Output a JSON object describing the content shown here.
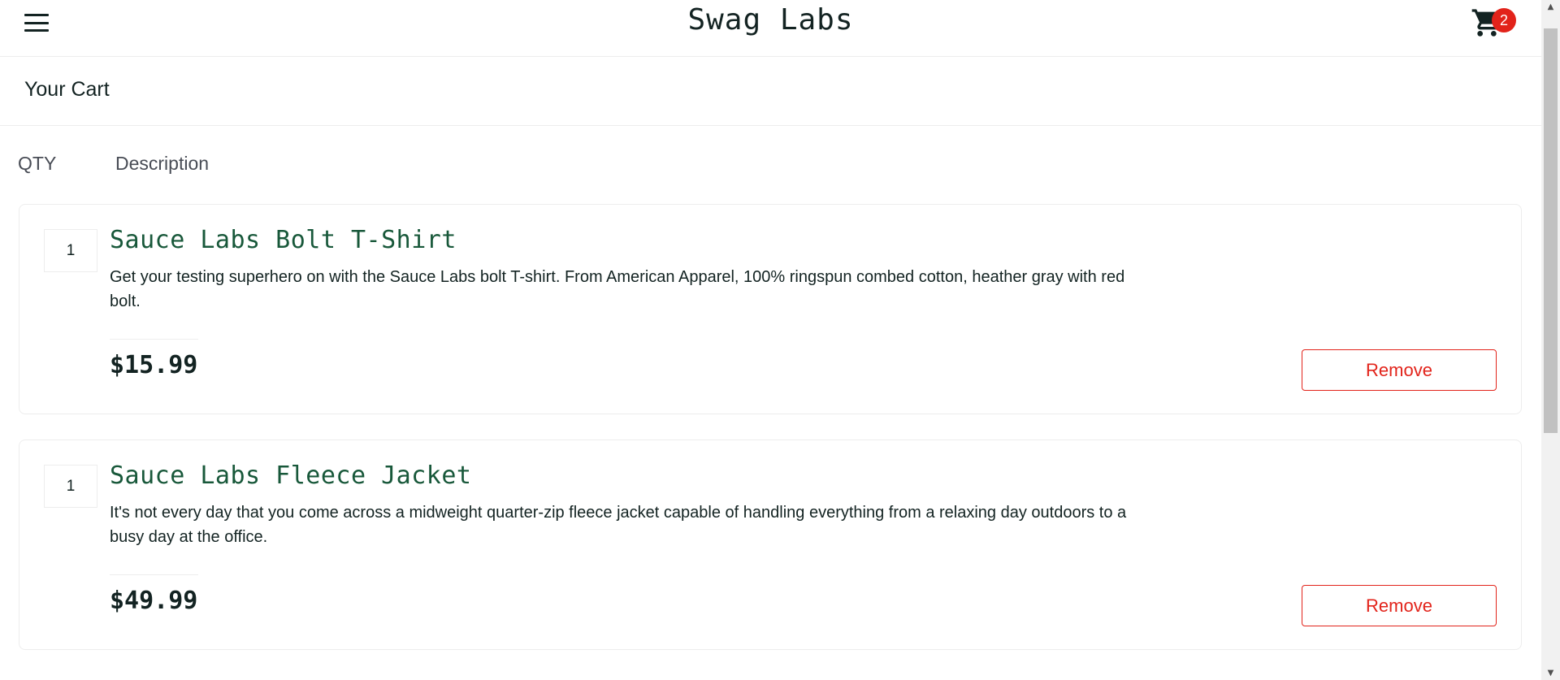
{
  "header": {
    "logo": "Swag Labs",
    "menu_icon": "hamburger-menu-icon",
    "cart_icon": "shopping-cart-icon",
    "cart_badge": "2",
    "accent_color": "#e2231a"
  },
  "secondary_header": {
    "title": "Your Cart"
  },
  "cart_list": {
    "qty_label": "QTY",
    "desc_label": "Description",
    "items": [
      {
        "quantity": "1",
        "name": "Sauce Labs Bolt T-Shirt",
        "description": "Get your testing superhero on with the Sauce Labs bolt T-shirt. From American Apparel, 100% ringspun combed cotton, heather gray with red bolt.",
        "price": "$15.99",
        "remove_label": "Remove"
      },
      {
        "quantity": "1",
        "name": "Sauce Labs Fleece Jacket",
        "description": "It's not every day that you come across a midweight quarter-zip fleece jacket capable of handling everything from a relaxing day outdoors to a busy day at the office.",
        "price": "$49.99",
        "remove_label": "Remove"
      }
    ]
  },
  "colors": {
    "item_name": "#18583a",
    "remove_button": "#e2231a",
    "text": "#132322"
  }
}
